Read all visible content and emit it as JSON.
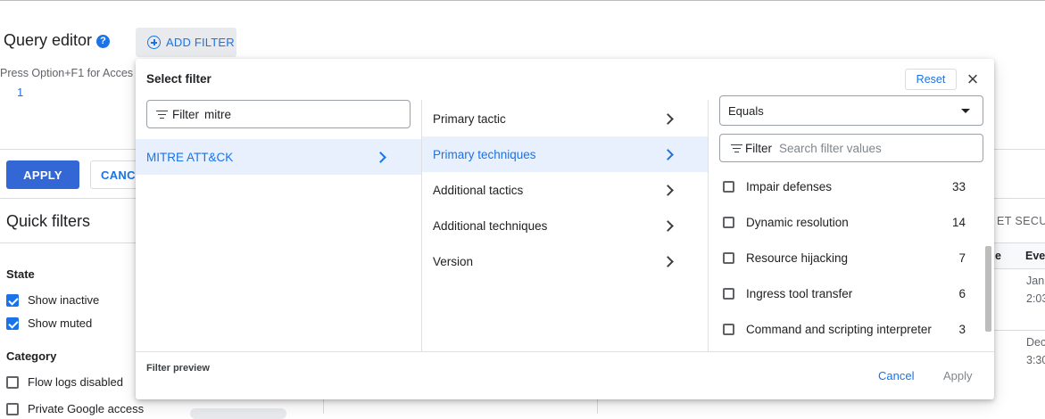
{
  "page": {
    "query_editor_title": "Query editor",
    "help_glyph": "?",
    "add_filter_label": "ADD FILTER",
    "access_hint": "Press Option+F1 for Acces",
    "line_number": "1",
    "apply_label": "APPLY",
    "cancel_label": "CANCE",
    "quick_filters_title": "Quick filters",
    "state_label": "State",
    "state_items": [
      {
        "label": "Show inactive",
        "checked": true
      },
      {
        "label": "Show muted",
        "checked": true
      }
    ],
    "category_label": "Category",
    "category_items": [
      {
        "label": "Flow logs disabled",
        "checked": false
      },
      {
        "label": "Private Google access",
        "checked": false
      }
    ],
    "right_header_partial": "ET SECURI",
    "right_col_partial_e": "e",
    "right_col_partial_ever": "Ever",
    "right_rows": [
      {
        "line1": "Jan",
        "line2": "2:03"
      },
      {
        "line1": "Dec",
        "line2": "3:30"
      }
    ]
  },
  "dialog": {
    "title": "Select filter",
    "reset_label": "Reset",
    "close_glyph": "×",
    "filter_prefix": "Filter",
    "filter_value": "mitre",
    "categories": [
      {
        "label": "MITRE ATT&CK",
        "selected": true
      }
    ],
    "attributes": [
      {
        "label": "Primary tactic",
        "selected": false
      },
      {
        "label": "Primary techniques",
        "selected": true
      },
      {
        "label": "Additional tactics",
        "selected": false
      },
      {
        "label": "Additional techniques",
        "selected": false
      },
      {
        "label": "Version",
        "selected": false
      }
    ],
    "operator": "Equals",
    "values_filter_prefix": "Filter",
    "values_filter_placeholder": "Search filter values",
    "values": [
      {
        "label": "Impair defenses",
        "count": "33"
      },
      {
        "label": "Dynamic resolution",
        "count": "14"
      },
      {
        "label": "Resource hijacking",
        "count": "7"
      },
      {
        "label": "Ingress tool transfer",
        "count": "6"
      },
      {
        "label": "Command and scripting interpreter",
        "count": "3"
      }
    ],
    "preview_label": "Filter preview",
    "cancel_label": "Cancel",
    "apply_label": "Apply"
  },
  "colors": {
    "accent": "#1a73e8",
    "primary_button": "#3367d6",
    "selected_row": "#e8f0fe"
  }
}
